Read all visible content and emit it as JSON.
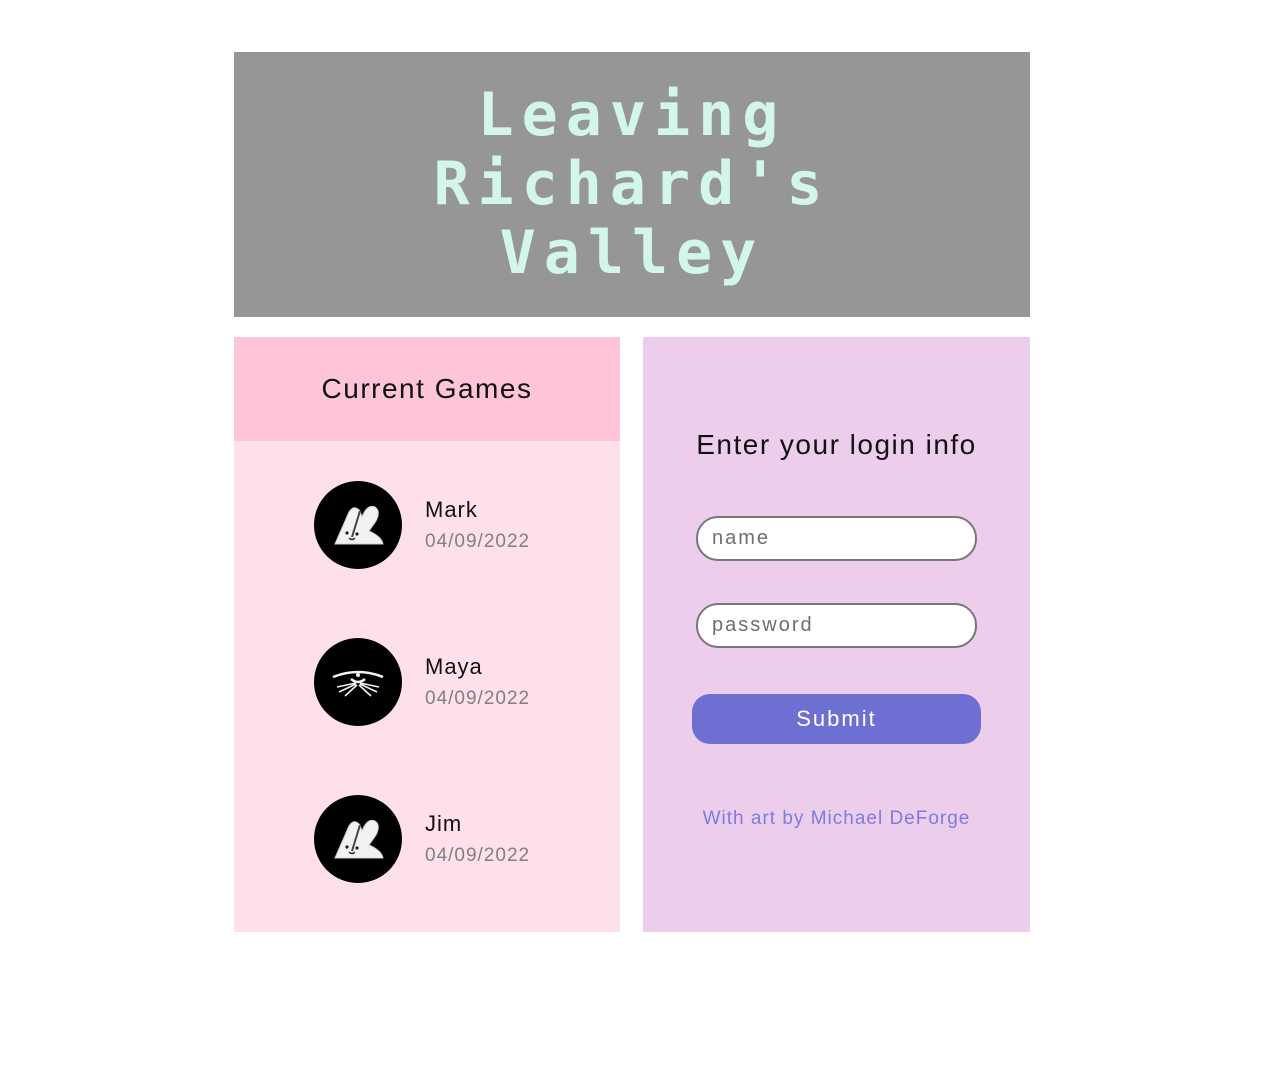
{
  "header": {
    "title_lines": [
      "Leaving",
      "Richard's",
      "Valley"
    ],
    "background": "#969696",
    "title_color": "#d2f7e9"
  },
  "games": {
    "title": "Current Games",
    "header_color": "#fdc4da",
    "panel_color": "#fde0ec",
    "items": [
      {
        "name": "Mark",
        "date": "04/09/2022",
        "avatar": "bunny-icon"
      },
      {
        "name": "Maya",
        "date": "04/09/2022",
        "avatar": "whiskers-face-icon"
      },
      {
        "name": "Jim",
        "date": "04/09/2022",
        "avatar": "bunny-icon"
      }
    ]
  },
  "login": {
    "title": "Enter your login info",
    "name_placeholder": "name",
    "password_placeholder": "password",
    "submit_label": "Submit",
    "credit": "With art by Michael DeForge",
    "panel_color": "#edcdec",
    "button_color": "#6e6fd2"
  }
}
